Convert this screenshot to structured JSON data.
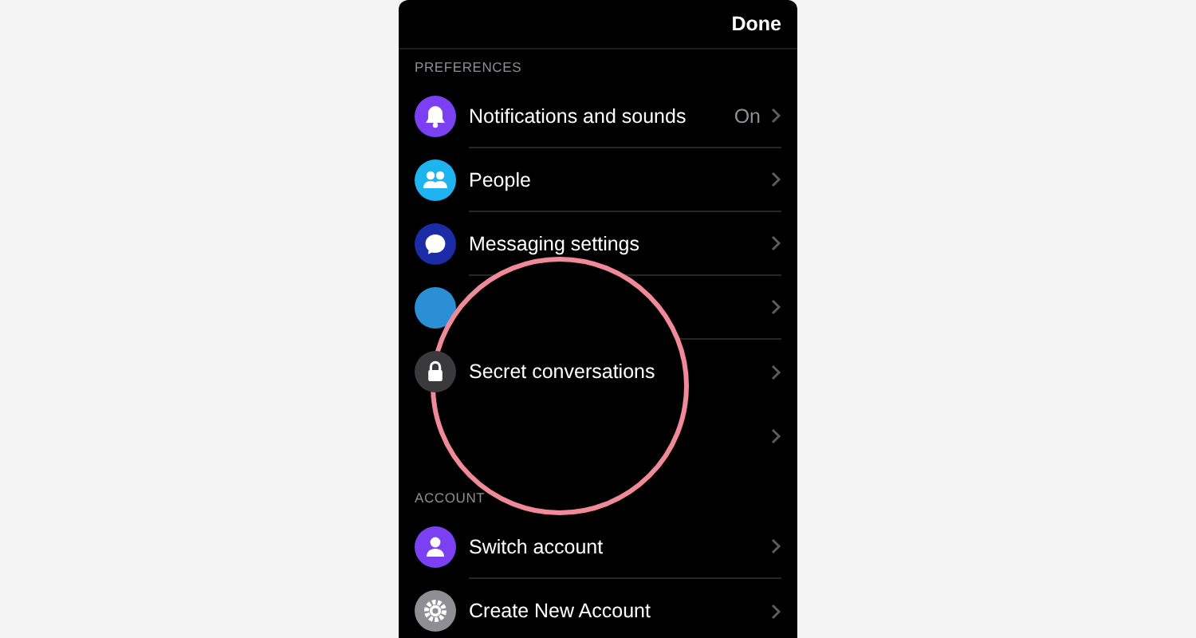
{
  "header": {
    "done": "Done"
  },
  "sections": [
    {
      "title": "PREFERENCES",
      "rows": [
        {
          "kind": "bell",
          "color": "#7a40f2",
          "label": "Notifications and sounds",
          "value": "On"
        },
        {
          "kind": "people",
          "color": "#1eb4ef",
          "label": "People"
        },
        {
          "kind": "bubble",
          "color": "#1b2ca6",
          "label": "Messaging settings"
        },
        {
          "kind": "blank",
          "color": "#2b8fd6"
        },
        {
          "kind": "lock",
          "color": "#3a3a3c",
          "label": "Secret conversations"
        },
        {
          "kind": "none"
        }
      ]
    },
    {
      "title": "ACCOUNT",
      "rows": [
        {
          "kind": "person",
          "color": "#7a40f2",
          "label": "Switch account"
        },
        {
          "kind": "gear",
          "color": "#8e8e93",
          "label": "Create New Account"
        }
      ]
    }
  ]
}
